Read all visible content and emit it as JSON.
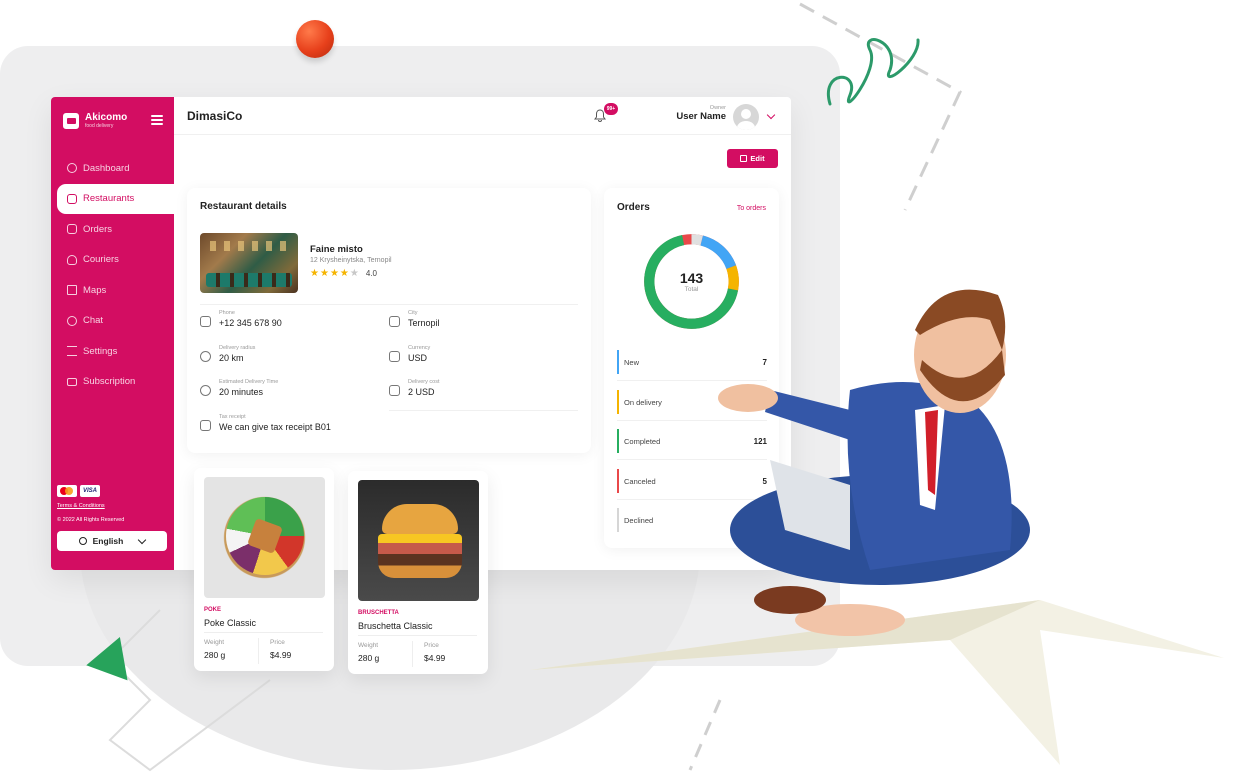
{
  "brand": {
    "name": "Akicomo",
    "tagline": "food delivery"
  },
  "sidebar": {
    "items": [
      {
        "label": "Dashboard",
        "icon": "dashboard-icon"
      },
      {
        "label": "Restaurants",
        "icon": "restaurant-icon",
        "active": true
      },
      {
        "label": "Orders",
        "icon": "orders-icon"
      },
      {
        "label": "Couriers",
        "icon": "couriers-icon"
      },
      {
        "label": "Maps",
        "icon": "map-icon"
      },
      {
        "label": "Chat",
        "icon": "chat-icon"
      },
      {
        "label": "Settings",
        "icon": "settings-icon"
      },
      {
        "label": "Subscription",
        "icon": "subscription-icon"
      }
    ],
    "visa_label": "VISA",
    "terms": "Terms & Conditions",
    "copyright": "© 2022 All Rights Reserved",
    "language": "English"
  },
  "header": {
    "company": "DimasiCo",
    "notification_badge": "99+",
    "user_role": "Owner",
    "user_name": "User Name"
  },
  "edit_label": "Edit",
  "restaurant": {
    "section_title": "Restaurant details",
    "name": "Faine misto",
    "address": "12 Krysheinytska, Ternopil",
    "rating": "4.0",
    "stars": 4,
    "fields": {
      "phone": {
        "label": "Phone",
        "value": "+12 345 678 90"
      },
      "city": {
        "label": "City",
        "value": "Ternopil"
      },
      "radius": {
        "label": "Delivery radius",
        "value": "20 km"
      },
      "currency": {
        "label": "Currency",
        "value": "USD"
      },
      "time": {
        "label": "Estimated Delivery Time",
        "value": "20 minutes"
      },
      "cost": {
        "label": "Delivery cost",
        "value": "2 USD"
      },
      "tax": {
        "label": "Tax receipt",
        "value": "We can give tax receipt B01"
      }
    }
  },
  "orders": {
    "title": "Orders",
    "link": "To orders",
    "total": "143",
    "total_label": "Total",
    "stats": [
      {
        "label": "New",
        "count": "7",
        "color": "#42a5f5"
      },
      {
        "label": "On delivery",
        "count": "",
        "color": "#f5b400"
      },
      {
        "label": "Completed",
        "count": "121",
        "color": "#27ae60"
      },
      {
        "label": "Canceled",
        "count": "5",
        "color": "#e9484a"
      },
      {
        "label": "Declined",
        "count": "",
        "color": "#d6d6d6"
      }
    ]
  },
  "dishes": [
    {
      "category": "POKE",
      "name": "Poke Classic",
      "weight_label": "Weight",
      "weight": "280 g",
      "price_label": "Price",
      "price": "$4.99"
    },
    {
      "category": "BRUSCHETTA",
      "name": "Bruschetta Classic",
      "weight_label": "Weight",
      "weight": "280 g",
      "price_label": "Price",
      "price": "$4.99"
    }
  ],
  "colors": {
    "accent": "#d30d62",
    "background": "#eeeeef"
  }
}
